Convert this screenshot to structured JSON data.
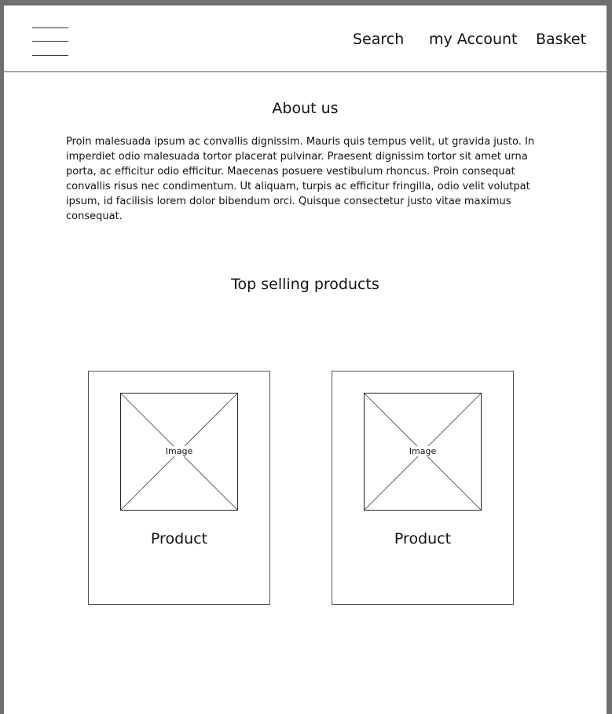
{
  "header": {
    "menu_icon": "hamburger-menu-icon",
    "nav": {
      "search": "Search",
      "account": "my Account",
      "basket": "Basket"
    }
  },
  "about": {
    "title": "About us",
    "text": "Proin malesuada ipsum ac convallis dignissim. Mauris quis tempus velit, ut gravida justo. In imperdiet odio malesuada tortor placerat pulvinar. Praesent dignissim tortor sit amet urna porta, ac efficitur odio efficitur. Maecenas posuere vestibulum rhoncus. Proin consequat convallis risus nec condimentum. Ut aliquam, turpis ac efficitur fringilla, odio velit volutpat ipsum, id facilisis lorem dolor bibendum orci. Quisque consectetur justo vitae maximus consequat."
  },
  "top_products": {
    "title": "Top selling products",
    "items": [
      {
        "image_label": "Image",
        "name": "Product"
      },
      {
        "image_label": "Image",
        "name": "Product"
      }
    ]
  }
}
